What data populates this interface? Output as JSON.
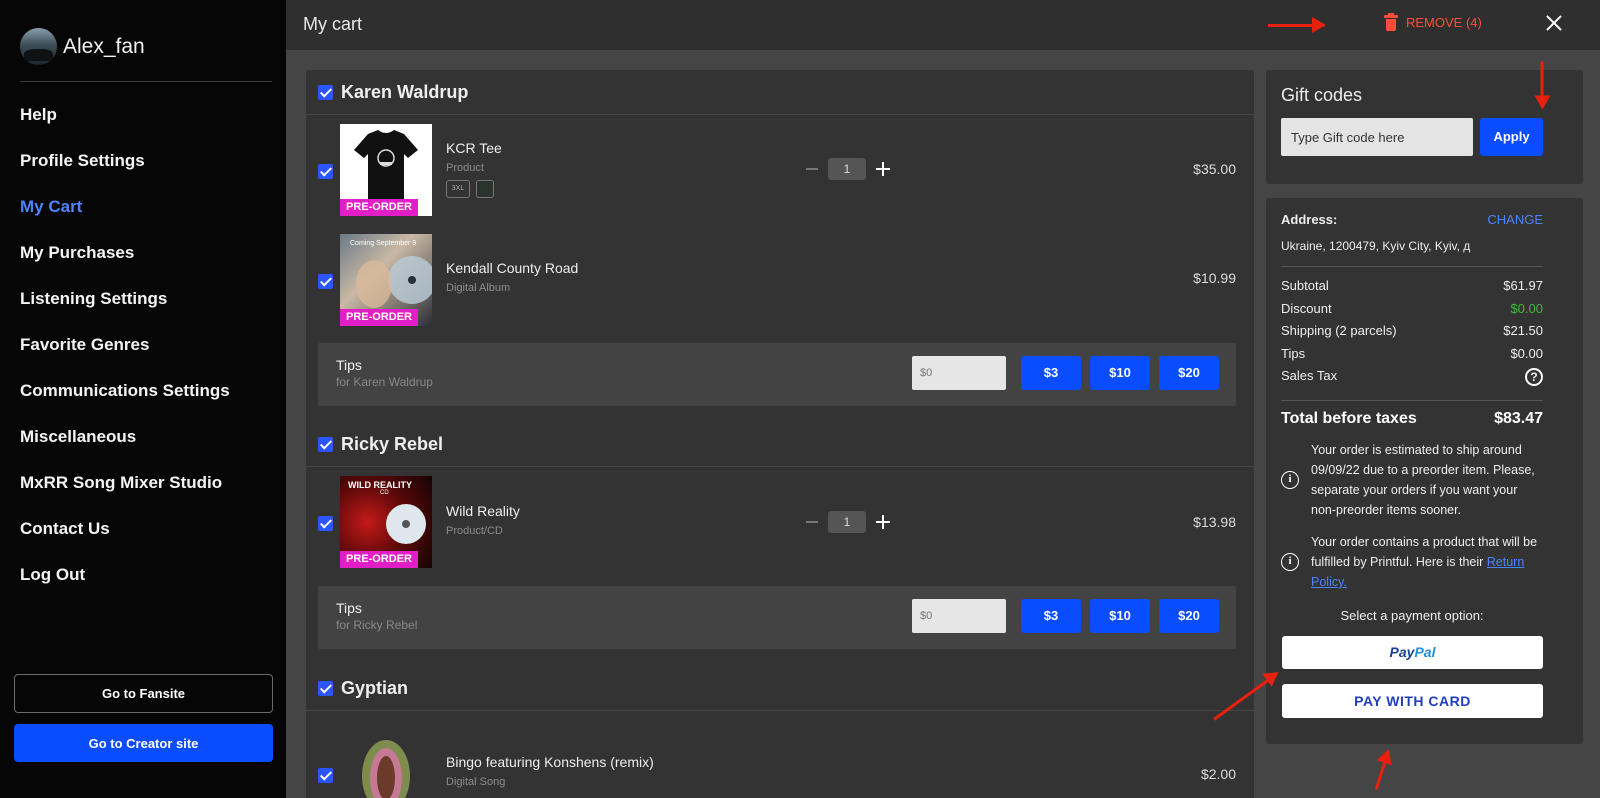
{
  "sidebar": {
    "username": "Alex_fan",
    "items": [
      {
        "label": "Help"
      },
      {
        "label": "Profile Settings"
      },
      {
        "label": "My Cart"
      },
      {
        "label": "My Purchases"
      },
      {
        "label": "Listening Settings"
      },
      {
        "label": "Favorite Genres"
      },
      {
        "label": "Communications Settings"
      },
      {
        "label": "Miscellaneous"
      },
      {
        "label": "MxRR Song Mixer Studio"
      },
      {
        "label": "Contact Us"
      },
      {
        "label": "Log Out"
      }
    ],
    "active_item": "My Cart",
    "fansite_button": "Go to Fansite",
    "creator_button": "Go to Creator site"
  },
  "header": {
    "title": "My cart",
    "remove_label": "REMOVE (4)"
  },
  "cart": {
    "sellers": [
      {
        "name": "Karen Waldrup",
        "items": [
          {
            "name": "KCR Tee",
            "type": "Product",
            "badge": "PRE-ORDER",
            "qty": "1",
            "price": "$35.00",
            "size": "3XL"
          },
          {
            "name": "Kendall County Road",
            "type": "Digital Album",
            "badge": "PRE-ORDER",
            "price": "$10.99",
            "thumb_text": "Coming September 9"
          }
        ],
        "tips": {
          "title": "Tips",
          "subtitle": "for Karen Waldrup",
          "placeholder": "$0",
          "options": [
            "$3",
            "$10",
            "$20"
          ]
        }
      },
      {
        "name": "Ricky Rebel",
        "items": [
          {
            "name": "Wild Reality",
            "type": "Product/CD",
            "badge": "PRE-ORDER",
            "qty": "1",
            "price": "$13.98",
            "thumb_text": "WILD REALITY",
            "thumb_sub": "CD"
          }
        ],
        "tips": {
          "title": "Tips",
          "subtitle": "for Ricky Rebel",
          "placeholder": "$0",
          "options": [
            "$3",
            "$10",
            "$20"
          ]
        }
      },
      {
        "name": "Gyptian",
        "items": [
          {
            "name": "Bingo featuring Konshens (remix)",
            "type": "Digital Song",
            "price": "$2.00"
          }
        ]
      }
    ]
  },
  "gift": {
    "title": "Gift codes",
    "placeholder": "Type Gift code here",
    "apply_label": "Apply"
  },
  "summary": {
    "address_label": "Address:",
    "change_label": "CHANGE",
    "address": "Ukraine, 1200479, Kyiv City, Kyiv, д",
    "rows": [
      {
        "label": "Subtotal",
        "value": "$61.97"
      },
      {
        "label": "Discount",
        "value": "$0.00"
      },
      {
        "label": "Shipping (2 parcels)",
        "value": "$21.50"
      },
      {
        "label": "Tips",
        "value": "$0.00"
      },
      {
        "label": "Sales Tax",
        "value": ""
      }
    ],
    "total_label": "Total before taxes",
    "total_value": "$83.47",
    "info_1": "Your order is estimated to ship around 09/09/22 due to a preorder item. Please, separate your orders if you want your non-preorder items sooner.",
    "info_2_text": "Your order contains a product that will be fulfilled by Printful. Here is their",
    "info_2_link": "Return Policy.",
    "payment_label": "Select a payment option:",
    "paypal_pay": "Pay",
    "paypal_pal": "Pal",
    "card_label": "PAY WITH CARD"
  },
  "colors": {
    "accent": "#0a4dff",
    "active_nav": "#4c84ff",
    "remove": "#ff4c3b",
    "preorder": "#e21ec6",
    "annotation_arrow": "#e8200e",
    "discount": "#3fba3f"
  }
}
